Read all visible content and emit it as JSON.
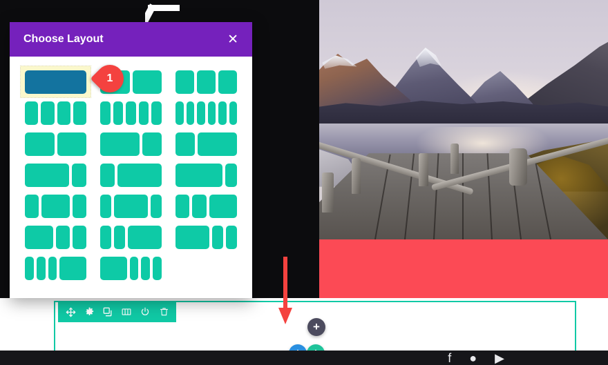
{
  "modal": {
    "title": "Choose Layout",
    "close_label": "✕",
    "selected_index": 0,
    "layouts": [
      {
        "name": "1-column",
        "cols": [
          1
        ]
      },
      {
        "name": "2-column-equal",
        "cols": [
          1,
          1
        ]
      },
      {
        "name": "3-column-equal",
        "cols": [
          1,
          1,
          1
        ]
      },
      {
        "name": "4-column-equal",
        "cols": [
          1,
          1,
          1,
          1
        ]
      },
      {
        "name": "5-column-equal",
        "cols": [
          1,
          1,
          1,
          1,
          1
        ]
      },
      {
        "name": "6-column-equal",
        "cols": [
          1,
          1,
          1,
          1,
          1,
          1
        ]
      },
      {
        "name": "2-column-half-half",
        "cols": [
          1,
          1
        ]
      },
      {
        "name": "2-column-two-thirds-one-third",
        "cols": [
          2,
          1
        ]
      },
      {
        "name": "2-column-one-third-two-thirds",
        "cols": [
          1,
          2
        ]
      },
      {
        "name": "2-column-three-quarter-one-quarter",
        "cols": [
          3,
          1
        ]
      },
      {
        "name": "2-column-one-quarter-three-quarter",
        "cols": [
          1,
          3
        ]
      },
      {
        "name": "2-column-wide-narrow",
        "cols": [
          4,
          1
        ]
      },
      {
        "name": "3-column-narrow-wide-narrow",
        "cols": [
          1,
          2,
          1
        ]
      },
      {
        "name": "3-column-narrow-wider-narrow",
        "cols": [
          1,
          3,
          1
        ]
      },
      {
        "name": "3-column-narrow-narrow-wide",
        "cols": [
          1,
          1,
          2
        ]
      },
      {
        "name": "3-column-wide-narrow-narrow",
        "cols": [
          2,
          1,
          1
        ]
      },
      {
        "name": "3-column-narrow-narrow-wider",
        "cols": [
          1,
          1,
          3
        ]
      },
      {
        "name": "3-column-wider-narrow-narrow",
        "cols": [
          3,
          1,
          1
        ]
      },
      {
        "name": "4-column-three-narrow-one-wide",
        "cols": [
          1,
          1,
          1,
          3
        ]
      },
      {
        "name": "4-column-one-wide-three-narrow",
        "cols": [
          3,
          1,
          1,
          1
        ]
      }
    ]
  },
  "annotation": {
    "pin_number": "1",
    "arrow_direction": "down"
  },
  "row_toolbar": {
    "items": [
      {
        "name": "move-icon",
        "label": "Move"
      },
      {
        "name": "gear-icon",
        "label": "Settings"
      },
      {
        "name": "duplicate-icon",
        "label": "Duplicate"
      },
      {
        "name": "columns-icon",
        "label": "Change Column Structure"
      },
      {
        "name": "power-icon",
        "label": "Disable"
      },
      {
        "name": "trash-icon",
        "label": "Delete"
      }
    ]
  },
  "add_buttons": {
    "module": {
      "label": "+",
      "color": "#4c4b5e",
      "name": "add-module-button"
    },
    "row": {
      "label": "+",
      "color": "#2a8fe0",
      "name": "add-row-button"
    },
    "section": {
      "label": "+",
      "color": "#1fc39a",
      "name": "add-section-button"
    }
  },
  "footer": {
    "social": [
      "f",
      "●",
      "▶"
    ]
  },
  "colors": {
    "modal_header": "#7521bc",
    "layout_teal": "#0ecaa6",
    "layout_selected": "#13739f",
    "selected_bg": "#fbf8cc",
    "row_accent": "#10c9a5",
    "annotation_red": "#f4423f",
    "hero_block_red": "#fc4a55"
  }
}
